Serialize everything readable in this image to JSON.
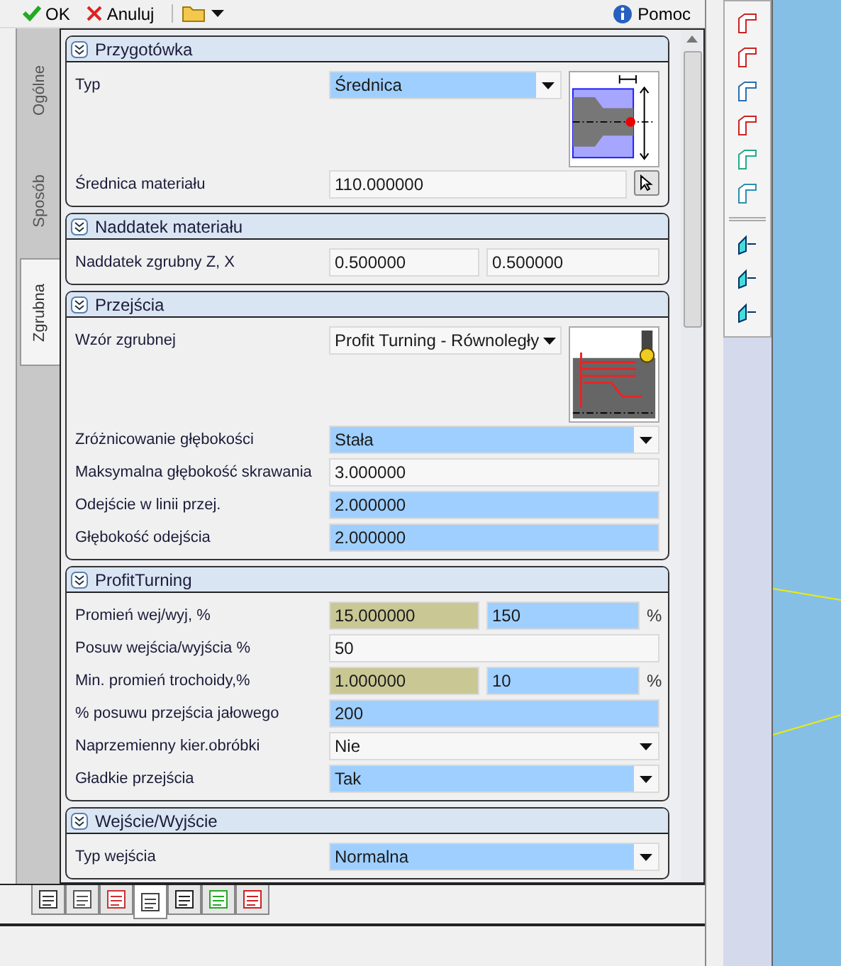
{
  "toolbar": {
    "ok": "OK",
    "cancel": "Anuluj",
    "help": "Pomoc"
  },
  "side_tabs": [
    {
      "label": "Ogólne",
      "selected": false
    },
    {
      "label": "Sposób",
      "selected": false
    },
    {
      "label": "Zgrubna",
      "selected": true
    }
  ],
  "sections": [
    {
      "title": "Przygotówka",
      "rows": [
        {
          "label": "Typ",
          "kind": "stock_preview",
          "fields": [
            {
              "kind": "select",
              "value": "Średnica",
              "color": "#9fcfff"
            }
          ]
        },
        {
          "label": "Średnica materiału",
          "pick_button": true,
          "fields": [
            {
              "kind": "text",
              "value": "110.000000",
              "color": "#f7f7f7"
            }
          ]
        }
      ]
    },
    {
      "title": "Naddatek materiału",
      "rows": [
        {
          "label": "Naddatek zgrubny Z, X",
          "fields": [
            {
              "kind": "text",
              "value": "0.500000",
              "color": "#f7f7f7"
            },
            {
              "kind": "text",
              "value": "0.500000",
              "color": "#f7f7f7"
            }
          ]
        }
      ]
    },
    {
      "title": "Przejścia",
      "rows": [
        {
          "label": "Wzór zgrubnej",
          "kind": "toolpath_preview",
          "fields": [
            {
              "kind": "select",
              "value": "Profit Turning - Równoległy",
              "color": "#f7f7f7"
            }
          ]
        },
        {
          "label": "Zróżnicowanie głębokości",
          "fields": [
            {
              "kind": "select",
              "value": "Stała",
              "color": "#9fcfff"
            }
          ]
        },
        {
          "label": "Maksymalna głębokość skrawania",
          "fields": [
            {
              "kind": "text",
              "value": "3.000000",
              "color": "#f7f7f7"
            }
          ]
        },
        {
          "label": "Odejście w linii przej.",
          "fields": [
            {
              "kind": "text",
              "value": "2.000000",
              "color": "#9fcfff"
            }
          ]
        },
        {
          "label": "Głębokość odejścia",
          "fields": [
            {
              "kind": "text",
              "value": "2.000000",
              "color": "#9fcfff"
            }
          ]
        }
      ]
    },
    {
      "title": "ProfitTurning",
      "rows": [
        {
          "label": "Promień wej/wyj, %",
          "unit": "%",
          "fields": [
            {
              "kind": "text",
              "value": "15.000000",
              "color": "#c9c895"
            },
            {
              "kind": "text",
              "value": "150",
              "color": "#9fcfff"
            }
          ]
        },
        {
          "label": "Posuw wejścia/wyjścia %",
          "fields": [
            {
              "kind": "text",
              "value": "50",
              "color": "#f7f7f7"
            }
          ]
        },
        {
          "label": "Min. promień trochoidy,%",
          "unit": "%",
          "fields": [
            {
              "kind": "text",
              "value": "1.000000",
              "color": "#c9c895"
            },
            {
              "kind": "text",
              "value": "10",
              "color": "#9fcfff"
            }
          ]
        },
        {
          "label": "% posuwu przejścia jałowego",
          "fields": [
            {
              "kind": "text",
              "value": "200",
              "color": "#9fcfff"
            }
          ]
        },
        {
          "label": "Naprzemienny kier.obróbki",
          "fields": [
            {
              "kind": "select",
              "value": "Nie",
              "color": "#f7f7f7"
            }
          ]
        },
        {
          "label": "Gładkie przejścia",
          "fields": [
            {
              "kind": "select",
              "value": "Tak",
              "color": "#9fcfff"
            }
          ]
        }
      ]
    },
    {
      "title": "Wejście/Wyjście",
      "rows": [
        {
          "label": "Typ wejścia",
          "fields": [
            {
              "kind": "select",
              "value": "Normalna",
              "color": "#9fcfff"
            }
          ]
        }
      ]
    }
  ],
  "bottom_tabs": [
    {
      "selected": false
    },
    {
      "selected": false
    },
    {
      "selected": false
    },
    {
      "selected": true
    },
    {
      "selected": false
    },
    {
      "selected": false
    },
    {
      "selected": false
    }
  ]
}
